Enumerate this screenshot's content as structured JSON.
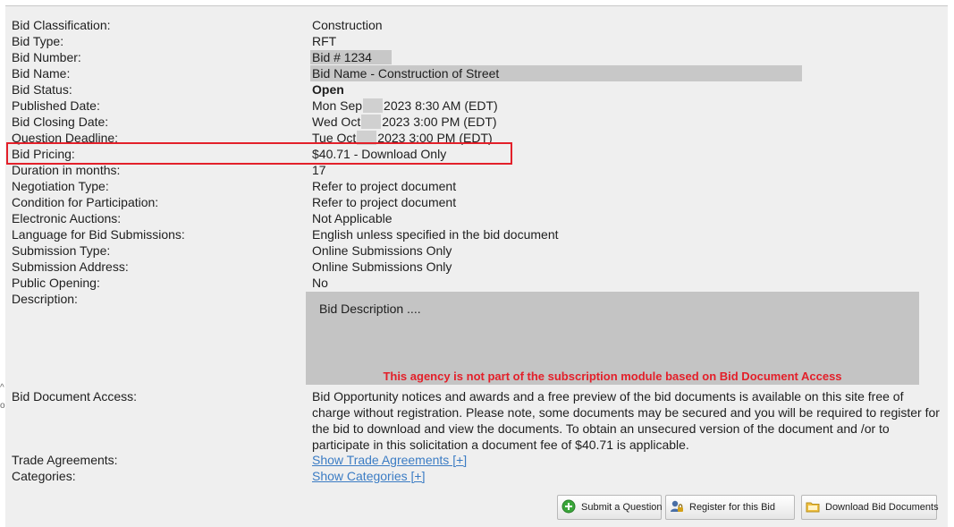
{
  "fields": [
    {
      "label": "Bid Classification:",
      "value": "Construction"
    },
    {
      "label": "Bid Type:",
      "value": "RFT"
    },
    {
      "label": "Bid Number:",
      "value": "Bid # 1234"
    },
    {
      "label": "Bid Name:",
      "value": "Bid Name - Construction of Street"
    },
    {
      "label": "Bid Status:",
      "value": "Open"
    },
    {
      "label": "Published Date:",
      "value_a": "Mon Sep",
      "value_b": "2023 8:30 AM (EDT)"
    },
    {
      "label": "Bid Closing Date:",
      "value_a": "Wed Oct",
      "value_b": "2023 3:00 PM (EDT)"
    },
    {
      "label": "Question Deadline:",
      "value_a": "Tue Oct",
      "value_b": "2023 3:00 PM (EDT)"
    },
    {
      "label": "Bid Pricing:",
      "value": "$40.71 - Download Only"
    },
    {
      "label": "Duration in months:",
      "value": "17"
    },
    {
      "label": "Negotiation Type:",
      "value": "Refer to project document"
    },
    {
      "label": "Condition for Participation:",
      "value": "Refer to project document"
    },
    {
      "label": "Electronic Auctions:",
      "value": "Not Applicable"
    },
    {
      "label": "Language for Bid Submissions:",
      "value": "English unless specified in the bid document"
    },
    {
      "label": "Submission Type:",
      "value": "Online Submissions Only"
    },
    {
      "label": "Submission Address:",
      "value": "Online Submissions Only"
    },
    {
      "label": "Public Opening:",
      "value": "No"
    },
    {
      "label": "Description:"
    },
    {
      "label": "Bid Document Access:"
    },
    {
      "label": "Trade Agreements:",
      "link": "Show Trade Agreements [+]"
    },
    {
      "label": "Categories:",
      "link": "Show Categories [+]"
    }
  ],
  "description": {
    "text": "Bid Description ....",
    "warning": "This agency is not part of the subscription module based on Bid Document Access"
  },
  "access_text": "Bid Opportunity notices and awards and a free preview of the bid documents is available on this site free of charge without registration. Please note, some documents may be secured and you will be required to register for the bid to download and view the documents. To obtain an unsecured version of the document and /or to participate in this solicitation a document fee of $40.71 is applicable.",
  "buttons": {
    "question": "Submit a Question",
    "register": "Register for this Bid",
    "download": "Download Bid Documents"
  },
  "colors": {
    "highlight": "#e3202a",
    "link": "#3b7cc4",
    "panel": "#efefef",
    "description_box": "#c4c4c4"
  },
  "icons": {
    "question": "plus-circle-icon",
    "register": "user-lock-icon",
    "download": "folder-download-icon"
  }
}
